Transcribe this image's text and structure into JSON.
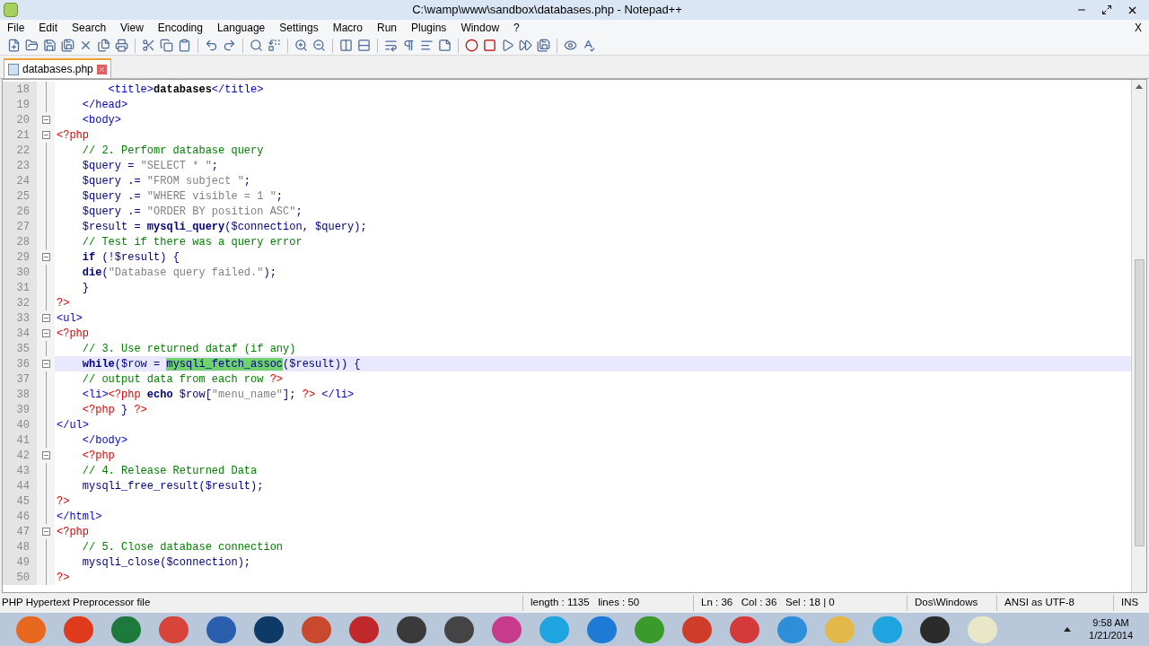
{
  "window": {
    "title": "C:\\wamp\\www\\sandbox\\databases.php - Notepad++"
  },
  "menu": [
    "File",
    "Edit",
    "Search",
    "View",
    "Encoding",
    "Language",
    "Settings",
    "Macro",
    "Run",
    "Plugins",
    "Window",
    "?"
  ],
  "menu_close": "X",
  "tabs": [
    {
      "label": "databases.php",
      "selected": true
    }
  ],
  "lines": [
    {
      "n": "18",
      "kind": "line",
      "current": false,
      "tokens": [
        {
          "kind": "tag",
          "t": "        <title>"
        },
        {
          "kind": "bold",
          "t": "databases"
        },
        {
          "kind": "tag",
          "t": "</title>"
        }
      ]
    },
    {
      "n": "19",
      "kind": "line",
      "current": false,
      "tokens": [
        {
          "kind": "tag",
          "t": "    </head>"
        }
      ]
    },
    {
      "n": "20",
      "kind": "open",
      "current": false,
      "tokens": [
        {
          "kind": "tag",
          "t": "    <body>"
        }
      ]
    },
    {
      "n": "21",
      "kind": "open",
      "current": false,
      "tokens": [
        {
          "kind": "php",
          "t": "<?php"
        }
      ]
    },
    {
      "n": "22",
      "kind": "line",
      "current": false,
      "tokens": [
        {
          "kind": "comment",
          "t": "    // 2. Perfomr database query"
        }
      ]
    },
    {
      "n": "23",
      "kind": "line",
      "current": false,
      "tokens": [
        {
          "kind": "var",
          "t": "    $query"
        },
        {
          "kind": "op",
          "t": " = "
        },
        {
          "kind": "string",
          "t": "\"SELECT * \""
        },
        {
          "kind": "op",
          "t": ";"
        }
      ]
    },
    {
      "n": "24",
      "kind": "line",
      "current": false,
      "tokens": [
        {
          "kind": "var",
          "t": "    $query"
        },
        {
          "kind": "op",
          "t": " .= "
        },
        {
          "kind": "string",
          "t": "\"FROM subject \""
        },
        {
          "kind": "op",
          "t": ";"
        }
      ]
    },
    {
      "n": "25",
      "kind": "line",
      "current": false,
      "tokens": [
        {
          "kind": "var",
          "t": "    $query"
        },
        {
          "kind": "op",
          "t": " .= "
        },
        {
          "kind": "string",
          "t": "\"WHERE visible = 1 \""
        },
        {
          "kind": "op",
          "t": ";"
        }
      ]
    },
    {
      "n": "26",
      "kind": "line",
      "current": false,
      "tokens": [
        {
          "kind": "var",
          "t": "    $query"
        },
        {
          "kind": "op",
          "t": " .= "
        },
        {
          "kind": "string",
          "t": "\"ORDER BY position ASC\""
        },
        {
          "kind": "op",
          "t": ";"
        }
      ]
    },
    {
      "n": "27",
      "kind": "line",
      "current": false,
      "tokens": [
        {
          "kind": "var",
          "t": "    $result"
        },
        {
          "kind": "op",
          "t": " = "
        },
        {
          "kind": "keyword",
          "t": "mysqli_query"
        },
        {
          "kind": "op",
          "t": "("
        },
        {
          "kind": "var",
          "t": "$connection, $query"
        },
        {
          "kind": "op",
          "t": ");"
        }
      ]
    },
    {
      "n": "28",
      "kind": "line",
      "current": false,
      "tokens": [
        {
          "kind": "comment",
          "t": "    // Test if there was a query error"
        }
      ]
    },
    {
      "n": "29",
      "kind": "open",
      "current": false,
      "tokens": [
        {
          "kind": "keyword",
          "t": "    if"
        },
        {
          "kind": "op",
          "t": " (!"
        },
        {
          "kind": "var",
          "t": "$result"
        },
        {
          "kind": "op",
          "t": ") {"
        }
      ]
    },
    {
      "n": "30",
      "kind": "line",
      "current": false,
      "tokens": [
        {
          "kind": "keyword",
          "t": "    die"
        },
        {
          "kind": "op",
          "t": "("
        },
        {
          "kind": "string",
          "t": "\"Database query failed.\""
        },
        {
          "kind": "op",
          "t": ");"
        }
      ]
    },
    {
      "n": "31",
      "kind": "end",
      "current": false,
      "tokens": [
        {
          "kind": "op",
          "t": "    }"
        }
      ]
    },
    {
      "n": "32",
      "kind": "end",
      "current": false,
      "tokens": [
        {
          "kind": "php",
          "t": "?>"
        }
      ]
    },
    {
      "n": "33",
      "kind": "open",
      "current": false,
      "tokens": [
        {
          "kind": "tag",
          "t": "<ul>"
        }
      ]
    },
    {
      "n": "34",
      "kind": "open",
      "current": false,
      "tokens": [
        {
          "kind": "php",
          "t": "<?php"
        }
      ]
    },
    {
      "n": "35",
      "kind": "line",
      "current": false,
      "tokens": [
        {
          "kind": "comment",
          "t": "    // 3. Use returned dataf (if any)"
        }
      ]
    },
    {
      "n": "36",
      "kind": "open",
      "current": true,
      "tokens": [
        {
          "kind": "keyword",
          "t": "    while"
        },
        {
          "kind": "op",
          "t": "("
        },
        {
          "kind": "var",
          "t": "$row"
        },
        {
          "kind": "op",
          "t": " = "
        },
        {
          "kind": "match",
          "t": "mysqli_fetch_assoc"
        },
        {
          "kind": "op",
          "t": "("
        },
        {
          "kind": "var",
          "t": "$result"
        },
        {
          "kind": "op",
          "t": ")) {"
        }
      ]
    },
    {
      "n": "37",
      "kind": "end",
      "current": false,
      "tokens": [
        {
          "kind": "comment",
          "t": "    // output data from each row "
        },
        {
          "kind": "php",
          "t": "?>"
        }
      ]
    },
    {
      "n": "38",
      "kind": "line",
      "current": false,
      "tokens": [
        {
          "kind": "tag",
          "t": "    <li>"
        },
        {
          "kind": "php",
          "t": "<?php "
        },
        {
          "kind": "keyword",
          "t": "echo"
        },
        {
          "kind": "var",
          "t": " $row"
        },
        {
          "kind": "op",
          "t": "["
        },
        {
          "kind": "string",
          "t": "\"menu_name\""
        },
        {
          "kind": "op",
          "t": "]; "
        },
        {
          "kind": "php",
          "t": "?>"
        },
        {
          "kind": "tag",
          "t": " </li>"
        }
      ]
    },
    {
      "n": "39",
      "kind": "line",
      "current": false,
      "tokens": [
        {
          "kind": "php",
          "t": "    <?php "
        },
        {
          "kind": "op",
          "t": "} "
        },
        {
          "kind": "php",
          "t": "?>"
        }
      ]
    },
    {
      "n": "40",
      "kind": "end",
      "current": false,
      "tokens": [
        {
          "kind": "tag",
          "t": "</ul>"
        }
      ]
    },
    {
      "n": "41",
      "kind": "line",
      "current": false,
      "tokens": [
        {
          "kind": "tag",
          "t": "    </body>"
        }
      ]
    },
    {
      "n": "42",
      "kind": "open",
      "current": false,
      "tokens": [
        {
          "kind": "php",
          "t": "    <?php"
        }
      ]
    },
    {
      "n": "43",
      "kind": "line",
      "current": false,
      "tokens": [
        {
          "kind": "comment",
          "t": "    // 4. Release Returned Data"
        }
      ]
    },
    {
      "n": "44",
      "kind": "line",
      "current": false,
      "tokens": [
        {
          "kind": "var",
          "t": "    mysqli_free_result"
        },
        {
          "kind": "op",
          "t": "("
        },
        {
          "kind": "var",
          "t": "$result"
        },
        {
          "kind": "op",
          "t": ");"
        }
      ]
    },
    {
      "n": "45",
      "kind": "end",
      "current": false,
      "tokens": [
        {
          "kind": "php",
          "t": "?>"
        }
      ]
    },
    {
      "n": "46",
      "kind": "end",
      "current": false,
      "tokens": [
        {
          "kind": "tag",
          "t": "</html>"
        }
      ]
    },
    {
      "n": "47",
      "kind": "open",
      "current": false,
      "tokens": [
        {
          "kind": "php",
          "t": "<?php"
        }
      ]
    },
    {
      "n": "48",
      "kind": "line",
      "current": false,
      "tokens": [
        {
          "kind": "comment",
          "t": "    // 5. Close database connection"
        }
      ]
    },
    {
      "n": "49",
      "kind": "line",
      "current": false,
      "tokens": [
        {
          "kind": "var",
          "t": "    mysqli_close"
        },
        {
          "kind": "op",
          "t": "("
        },
        {
          "kind": "var",
          "t": "$connection"
        },
        {
          "kind": "op",
          "t": ");"
        }
      ]
    },
    {
      "n": "50",
      "kind": "end",
      "current": false,
      "tokens": [
        {
          "kind": "php",
          "t": "?>"
        }
      ]
    }
  ],
  "status_bar": {
    "file_type": "PHP Hypertext Preprocessor file",
    "length": "length : 1135   lines : 50",
    "position": "Ln : 36   Col : 36   Sel : 18 | 0",
    "eol": "Dos\\Windows",
    "encoding": "ANSI as UTF-8",
    "mode": "INS"
  },
  "taskbar": {
    "time": "9:58 AM",
    "date": "1/21/2014"
  }
}
